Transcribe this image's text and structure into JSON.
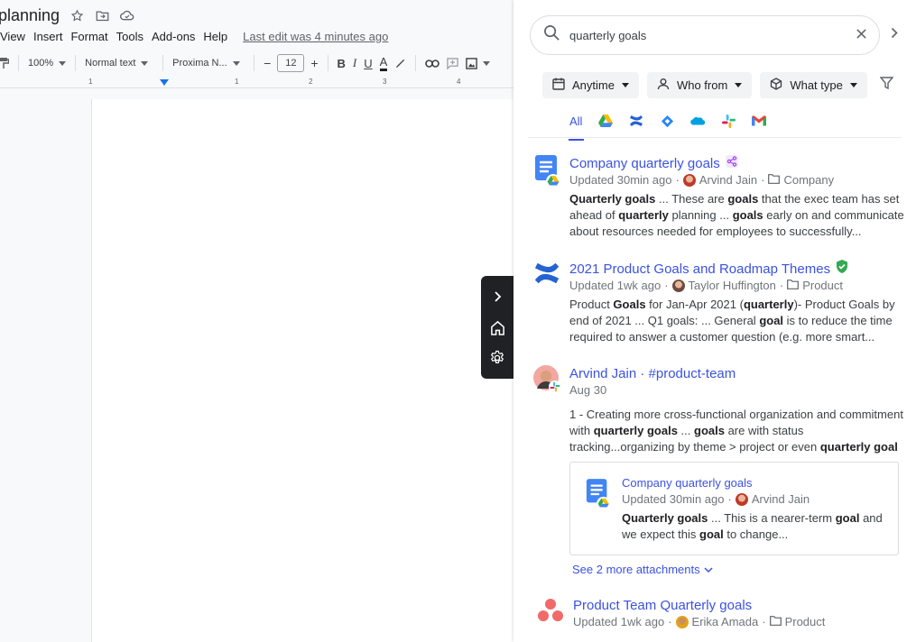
{
  "docs": {
    "title": "planning",
    "menu": [
      "View",
      "Insert",
      "Format",
      "Tools",
      "Add-ons",
      "Help"
    ],
    "last_edit": "Last edit was 4 minutes ago",
    "toolbar": {
      "zoom": "100%",
      "style": "Normal text",
      "font": "Proxima N...",
      "font_size": "12",
      "minus": "−",
      "plus": "+",
      "bold": "B",
      "italic": "I",
      "underline": "U",
      "text_color": "A"
    },
    "ruler_marks": [
      "1",
      "1",
      "2",
      "3",
      "4"
    ]
  },
  "side_control": {
    "icons": [
      "chevron-right-icon",
      "home-icon",
      "gear-icon"
    ]
  },
  "search": {
    "query": "quarterly goals",
    "filters": [
      {
        "label": "Anytime",
        "icon": "calendar-icon"
      },
      {
        "label": "Who from",
        "icon": "person-icon"
      },
      {
        "label": "What type",
        "icon": "cube-icon"
      }
    ],
    "tabs": {
      "all": "All",
      "apps": [
        "google-drive-icon",
        "confluence-icon",
        "jira-icon",
        "salesforce-icon",
        "slack-icon",
        "gmail-icon"
      ]
    }
  },
  "results": [
    {
      "title": "Company quarterly goals",
      "updated": "Updated 30min ago",
      "author": "Arvind Jain",
      "location": "Company",
      "snippet_parts": [
        {
          "t": "Quarterly goals",
          "b": true
        },
        {
          "t": " ... These are ",
          "b": false
        },
        {
          "t": "goals",
          "b": true
        },
        {
          "t": " that the exec team has set ahead of ",
          "b": false
        },
        {
          "t": "quarterly",
          "b": true
        },
        {
          "t": " planning ... ",
          "b": false
        },
        {
          "t": "goals",
          "b": true
        },
        {
          "t": " early on and communicate about resources needed for employees to successfully...",
          "b": false
        }
      ]
    },
    {
      "title": "2021 Product Goals and Roadmap Themes",
      "updated": "Updated 1wk ago",
      "author": "Taylor Huffington",
      "location": "Product",
      "snippet_parts": [
        {
          "t": "Product ",
          "b": false
        },
        {
          "t": "Goals",
          "b": true
        },
        {
          "t": " for Jan-Apr 2021 (",
          "b": false
        },
        {
          "t": "quarterly",
          "b": true
        },
        {
          "t": ")- Product Goals by end of 2021 ... Q1 goals: ... General ",
          "b": false
        },
        {
          "t": "goal",
          "b": true
        },
        {
          "t": " is to reduce the time required to answer a customer question (e.g. more smart...",
          "b": false
        }
      ]
    },
    {
      "title": "Arvind Jain · #product-team",
      "date": "Aug 30",
      "snippet_parts": [
        {
          "t": "1 - Creating more cross-functional organization and commitment with ",
          "b": false
        },
        {
          "t": "quarterly goals",
          "b": true
        },
        {
          "t": " ... ",
          "b": false
        },
        {
          "t": "goals",
          "b": true
        },
        {
          "t": " are with status tracking...organizing by theme > project or even ",
          "b": false
        },
        {
          "t": "quarterly goal",
          "b": true
        }
      ],
      "attachment": {
        "title": "Company quarterly goals",
        "updated": "Updated 30min ago",
        "author": "Arvind Jain",
        "snippet_parts": [
          {
            "t": "Quarterly goals",
            "b": true
          },
          {
            "t": " ... This is a nearer-term ",
            "b": false
          },
          {
            "t": "goal",
            "b": true
          },
          {
            "t": " and we expect this ",
            "b": false
          },
          {
            "t": "goal",
            "b": true
          },
          {
            "t": " to change...",
            "b": false
          }
        ]
      },
      "more_attachments": "See 2 more attachments"
    },
    {
      "title": "Product Team Quarterly goals",
      "updated": "Updated 1wk ago",
      "author": "Erika Amada",
      "location": "Product"
    }
  ],
  "colors": {
    "link": "#3b52e0",
    "docs_blue": "#4285f4",
    "verified_green": "#34a853",
    "share_purple": "#a142f4",
    "asana_coral": "#f06a6a"
  }
}
